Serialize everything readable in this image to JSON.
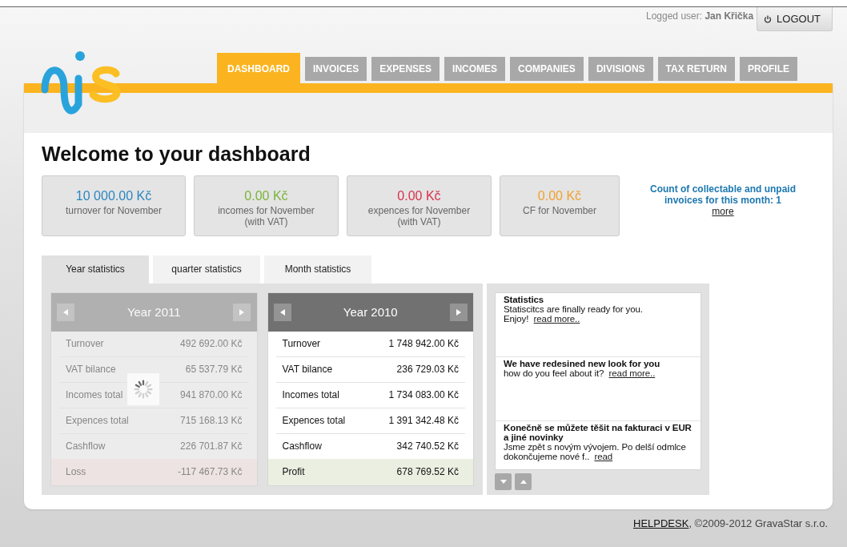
{
  "user": {
    "label": "Logged user:",
    "name": "Jan Křička",
    "logout": "LOGOUT"
  },
  "nav": [
    {
      "label": "DASHBOARD",
      "selected": true
    },
    {
      "label": "INVOICES",
      "selected": false
    },
    {
      "label": "EXPENSES",
      "selected": false
    },
    {
      "label": "INCOMES",
      "selected": false
    },
    {
      "label": "COMPANIES",
      "selected": false
    },
    {
      "label": "DIVISIONS",
      "selected": false
    },
    {
      "label": "TAX RETURN",
      "selected": false
    },
    {
      "label": "PROFILE",
      "selected": false
    }
  ],
  "title": "Welcome to your dashboard",
  "summary": [
    {
      "amount": "10 000.00 Kč",
      "label": "turnover for November",
      "color": "#2a86c0"
    },
    {
      "amount": "0.00 Kč",
      "label": "incomes for November\n(with VAT)",
      "color": "#7ab33a"
    },
    {
      "amount": "0.00 Kč",
      "label": "expences for November\n(with VAT)",
      "color": "#d8304a"
    },
    {
      "amount": "0.00 Kč",
      "label": "CF for November",
      "color": "#f0a030"
    }
  ],
  "notice": {
    "text": "Count of collectable and unpaid invoices for this month: 1",
    "link": "more"
  },
  "stat_tabs": [
    {
      "label": "Year statistics",
      "selected": true
    },
    {
      "label": "quarter statistics",
      "selected": false
    },
    {
      "label": "Month statistics",
      "selected": false
    }
  ],
  "years": [
    {
      "title": "Year 2011",
      "active": false,
      "loading": true,
      "rows": [
        {
          "label": "Turnover",
          "value": "492 692.00 Kč"
        },
        {
          "label": "VAT bilance",
          "value": "65 537.79 Kč"
        },
        {
          "label": "Incomes total",
          "value": "941 870.00 Kč"
        },
        {
          "label": "Expences total",
          "value": "715 168.13 Kč"
        },
        {
          "label": "Cashflow",
          "value": "226 701.87 Kč"
        }
      ],
      "result": {
        "kind": "loss",
        "label": "Loss",
        "value": "-117 467.73 Kč"
      }
    },
    {
      "title": "Year 2010",
      "active": true,
      "loading": false,
      "rows": [
        {
          "label": "Turnover",
          "value": "1 748 942.00 Kč"
        },
        {
          "label": "VAT bilance",
          "value": "236 729.03 Kč"
        },
        {
          "label": "Incomes total",
          "value": "1 734 083.00 Kč"
        },
        {
          "label": "Expences total",
          "value": "1 391 342.48 Kč"
        },
        {
          "label": "Cashflow",
          "value": "342 740.52 Kč"
        }
      ],
      "result": {
        "kind": "profit",
        "label": "Profit",
        "value": "678 769.52 Kč"
      }
    }
  ],
  "news": [
    {
      "title": "Statistics",
      "body": "Statiscitcs are finally ready for you. Enjoy!",
      "link": "read more.."
    },
    {
      "title": "We have redesined new look for you",
      "body": "how do you feel about it?",
      "link": "read more.."
    },
    {
      "title": "Konečně se můžete těšit na fakturaci v EUR a jiné novinky",
      "body": "Jsme zpět s novým vývojem. Po delší odmlce dokončujeme nové f..",
      "link": "read"
    }
  ],
  "footer": {
    "link": "HELPDESK",
    "text": ", ©2009-2012 GravaStar s.r.o."
  }
}
